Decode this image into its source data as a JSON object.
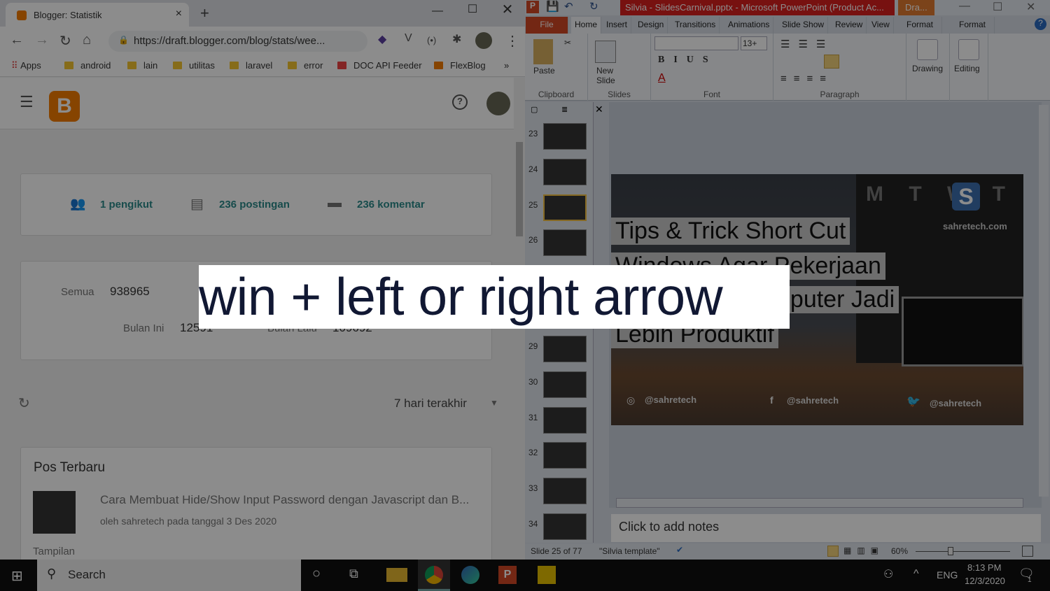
{
  "chrome": {
    "tab_title": "Blogger: Statistik",
    "url": "https://draft.blogger.com/blog/stats/wee...",
    "bookmarks": [
      "Apps",
      "android",
      "lain",
      "utilitas",
      "laravel",
      "error",
      "DOC API Feeder",
      "FlexBlog"
    ],
    "more": "»"
  },
  "blogger": {
    "followers": "1 pengikut",
    "posts": "236 postingan",
    "comments": "236 komentar",
    "views": [
      {
        "label": "Semua",
        "value": "938965"
      },
      {
        "label": "Bulan Ini",
        "value": "12591"
      },
      {
        "label": "Bulan Lalu",
        "value": "109692"
      }
    ],
    "range": "7 hari terakhir",
    "recent_title": "Pos Terbaru",
    "post_title": "Cara Membuat Hide/Show Input Password dengan Javascript dan B...",
    "post_meta": "oleh sahretech pada tanggal 3 Des 2020",
    "views_label": "Tampilan"
  },
  "ppt": {
    "title": "Silvia - SlidesCarnival.pptx  -  Microsoft PowerPoint (Product Ac...",
    "context_tab": "Dra...",
    "tabs": [
      "File",
      "Home",
      "Insert",
      "Design",
      "Transitions",
      "Animations",
      "Slide Show",
      "Review",
      "View",
      "Format",
      "Format"
    ],
    "groups": {
      "clipboard": "Clipboard",
      "slides": "Slides",
      "font": "Font",
      "paragraph": "Paragraph"
    },
    "paste": "Paste",
    "new_slide": "New Slide",
    "drawing": "Drawing",
    "editing": "Editing",
    "font_size": "13+",
    "thumb_numbers": [
      "23",
      "24",
      "25",
      "26",
      "29",
      "30",
      "31",
      "32",
      "33",
      "34"
    ],
    "slide_lines": [
      "Tips & Trick Short Cut",
      "Windows Agar Pekerjaan",
      "Komputer Jadi",
      "Lebih Produktif"
    ],
    "calendar": "M T W T F S",
    "site": "sahretech.com",
    "handles": [
      "@sahretech",
      "@sahretech",
      "@sahretech"
    ],
    "notes_placeholder": "Click to add notes",
    "status_slide": "Slide 25 of 77",
    "status_theme": "\"Silvia template\"",
    "zoom": "60%"
  },
  "taskbar": {
    "search": "Search",
    "lang": "ENG",
    "time": "8:13 PM",
    "date": "12/3/2020",
    "notif_count": "1"
  },
  "caption": "win + left or right arrow"
}
